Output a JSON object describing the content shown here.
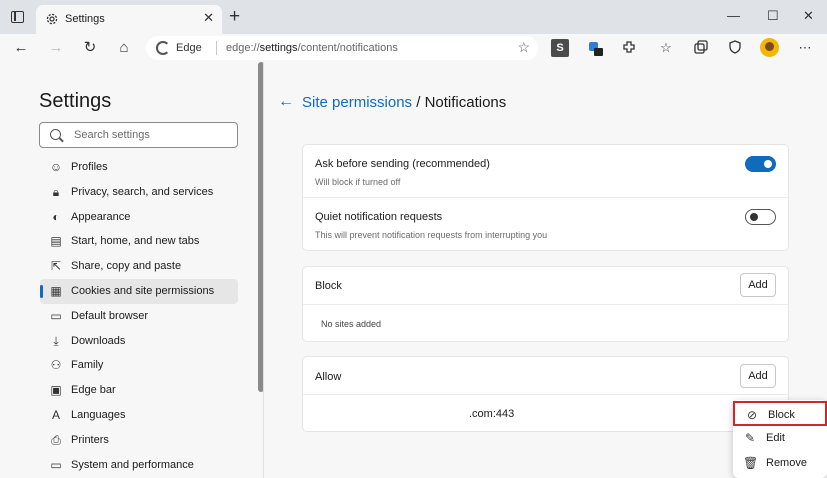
{
  "window": {
    "tab_title": "Settings",
    "tab_close": "✕",
    "new_tab": "+",
    "minimize": "—",
    "maximize": "☐",
    "close": "✕"
  },
  "toolbar": {
    "back": "←",
    "forward": "→",
    "refresh": "↻",
    "home": "⌂",
    "edge_label": "Edge",
    "url_scheme": "edge://",
    "url_path": "settings",
    "url_rest": "/content/notifications",
    "favorite_star": "☆",
    "more": "⋯"
  },
  "sidebar": {
    "title": "Settings",
    "search_placeholder": "Search settings",
    "items": [
      {
        "label": "Profiles",
        "icon": "profile-icon",
        "glyph": "☺"
      },
      {
        "label": "Privacy, search, and services",
        "icon": "lock-icon",
        "glyph": "🔒︎"
      },
      {
        "label": "Appearance",
        "icon": "appearance-icon",
        "glyph": "◐"
      },
      {
        "label": "Start, home, and new tabs",
        "icon": "start-icon",
        "glyph": "▤"
      },
      {
        "label": "Share, copy and paste",
        "icon": "share-icon",
        "glyph": "⇱"
      },
      {
        "label": "Cookies and site permissions",
        "icon": "cookies-icon",
        "glyph": "▦"
      },
      {
        "label": "Default browser",
        "icon": "browser-icon",
        "glyph": "▭"
      },
      {
        "label": "Downloads",
        "icon": "download-icon",
        "glyph": "⤓"
      },
      {
        "label": "Family",
        "icon": "family-icon",
        "glyph": "⚇"
      },
      {
        "label": "Edge bar",
        "icon": "edge-bar-icon",
        "glyph": "▣"
      },
      {
        "label": "Languages",
        "icon": "languages-icon",
        "glyph": "A"
      },
      {
        "label": "Printers",
        "icon": "printer-icon",
        "glyph": "⎙"
      },
      {
        "label": "System and performance",
        "icon": "system-icon",
        "glyph": "▭"
      }
    ],
    "active_index": 5
  },
  "main": {
    "back_arrow": "←",
    "breadcrumb_link": "Site permissions",
    "breadcrumb_sep": " / ",
    "breadcrumb_current": "Notifications",
    "ask": {
      "title": "Ask before sending (recommended)",
      "desc": "Will block if turned off",
      "enabled": true
    },
    "quiet": {
      "title": "Quiet notification requests",
      "desc": "This will prevent notification requests from interrupting you",
      "enabled": false
    },
    "block": {
      "title": "Block",
      "add_label": "Add",
      "empty_text": "No sites added"
    },
    "allow": {
      "title": "Allow",
      "add_label": "Add",
      "site": ".com:443"
    }
  },
  "context_menu": {
    "items": [
      {
        "label": "Block",
        "icon": "block-icon",
        "glyph": "⊘"
      },
      {
        "label": "Edit",
        "icon": "pencil-icon",
        "glyph": "✎"
      },
      {
        "label": "Remove",
        "icon": "trash-icon",
        "glyph": "🗑︎"
      }
    ]
  },
  "colors": {
    "accent": "#0f6cbd",
    "highlight_border": "#d0262e"
  }
}
